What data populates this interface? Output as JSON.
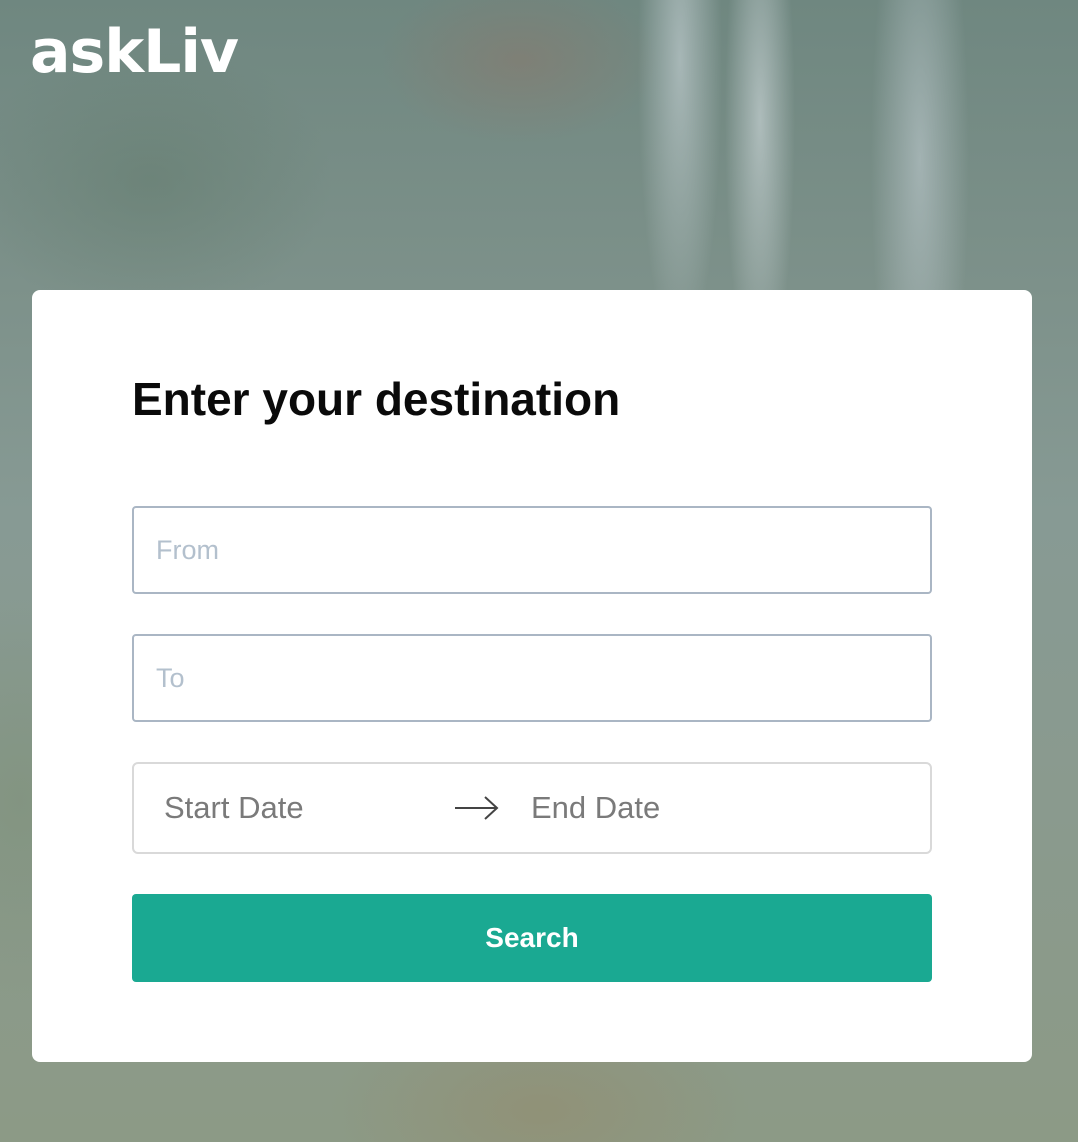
{
  "brand": {
    "logo_text": "askLiv"
  },
  "form": {
    "title": "Enter your destination",
    "from": {
      "value": "",
      "placeholder": "From"
    },
    "to": {
      "value": "",
      "placeholder": "To"
    },
    "date_range": {
      "start_placeholder": "Start Date",
      "end_placeholder": "End Date",
      "separator_icon": "arrow-right-icon"
    },
    "search_label": "Search"
  },
  "colors": {
    "accent": "#1aa992",
    "logo": "#ffffff",
    "input_border": "#aab6c4",
    "placeholder": "#b3c0cd"
  }
}
